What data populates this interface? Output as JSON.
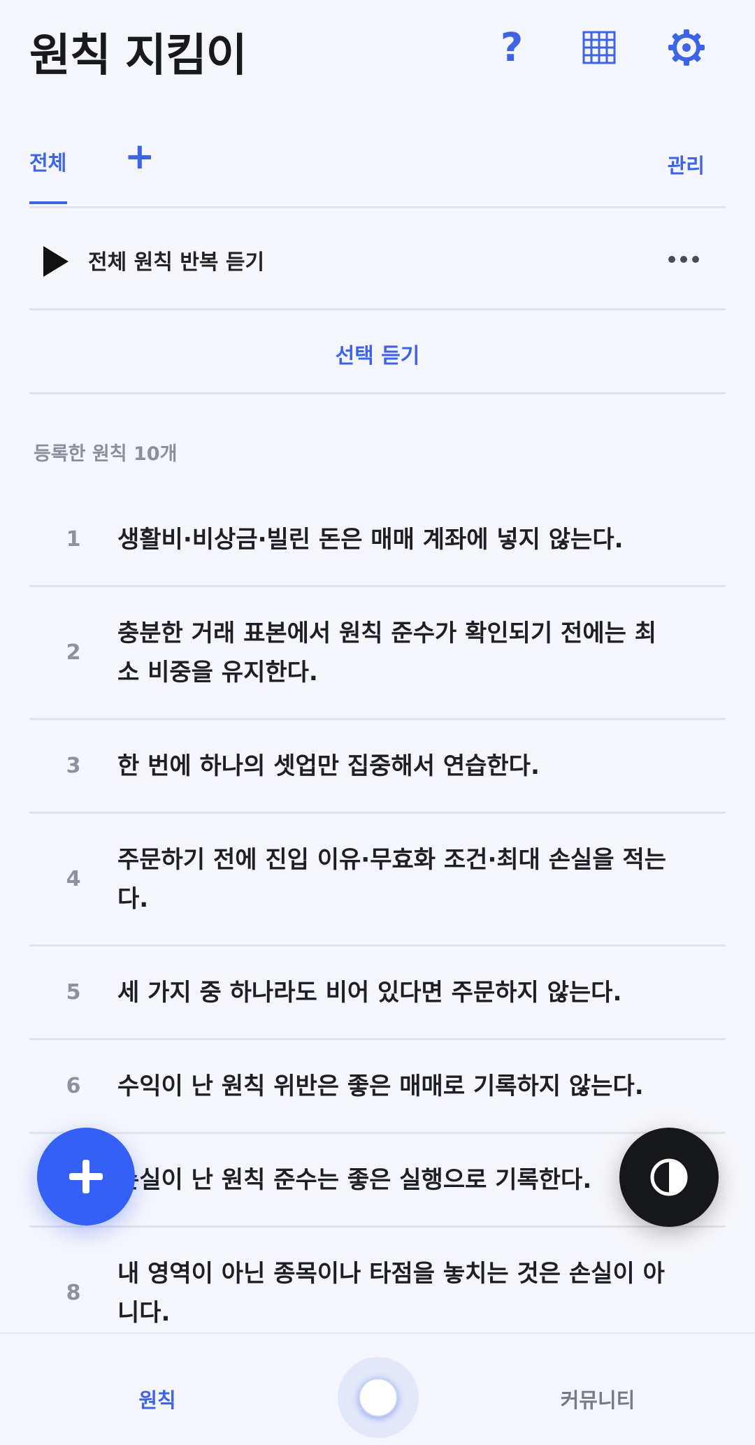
{
  "header": {
    "title": "원칙 지킴이",
    "help_glyph": "?",
    "icons": [
      "help-icon",
      "grid-icon",
      "gear-icon"
    ]
  },
  "tabs": {
    "all_label": "전체",
    "add_glyph": "+",
    "manage_label": "관리"
  },
  "player": {
    "repeat_label": "전체 원칙 반복 듣기",
    "select_listen_label": "선택 듣기"
  },
  "list": {
    "count_label": "등록한 원칙 10개",
    "items": [
      {
        "num": "1",
        "text": "생활비·비상금·빌린 돈은 매매 계좌에 넣지 않는다."
      },
      {
        "num": "2",
        "text": "충분한 거래 표본에서 원칙 준수가 확인되기 전에는 최소 비중을 유지한다."
      },
      {
        "num": "3",
        "text": "한 번에 하나의 셋업만 집중해서 연습한다."
      },
      {
        "num": "4",
        "text": "주문하기 전에 진입 이유·무효화 조건·최대 손실을 적는다."
      },
      {
        "num": "5",
        "text": "세 가지 중 하나라도 비어 있다면 주문하지 않는다."
      },
      {
        "num": "6",
        "text": "수익이 난 원칙 위반은 좋은 매매로 기록하지 않는다."
      },
      {
        "num": "7",
        "text": "손실이 난 원칙 준수는 좋은 실행으로 기록한다."
      },
      {
        "num": "8",
        "text": "내 영역이 아닌 종목이나 타점을 놓치는 것은 손실이 아니다."
      }
    ]
  },
  "fab": {
    "add_glyph": "+"
  },
  "bottom_nav": {
    "principles_label": "원칙",
    "community_label": "커뮤니티"
  },
  "colors": {
    "accent": "#3d63e6",
    "fab_add": "#3560f5",
    "fab_theme": "#16171b",
    "background": "#f5f6fb"
  }
}
